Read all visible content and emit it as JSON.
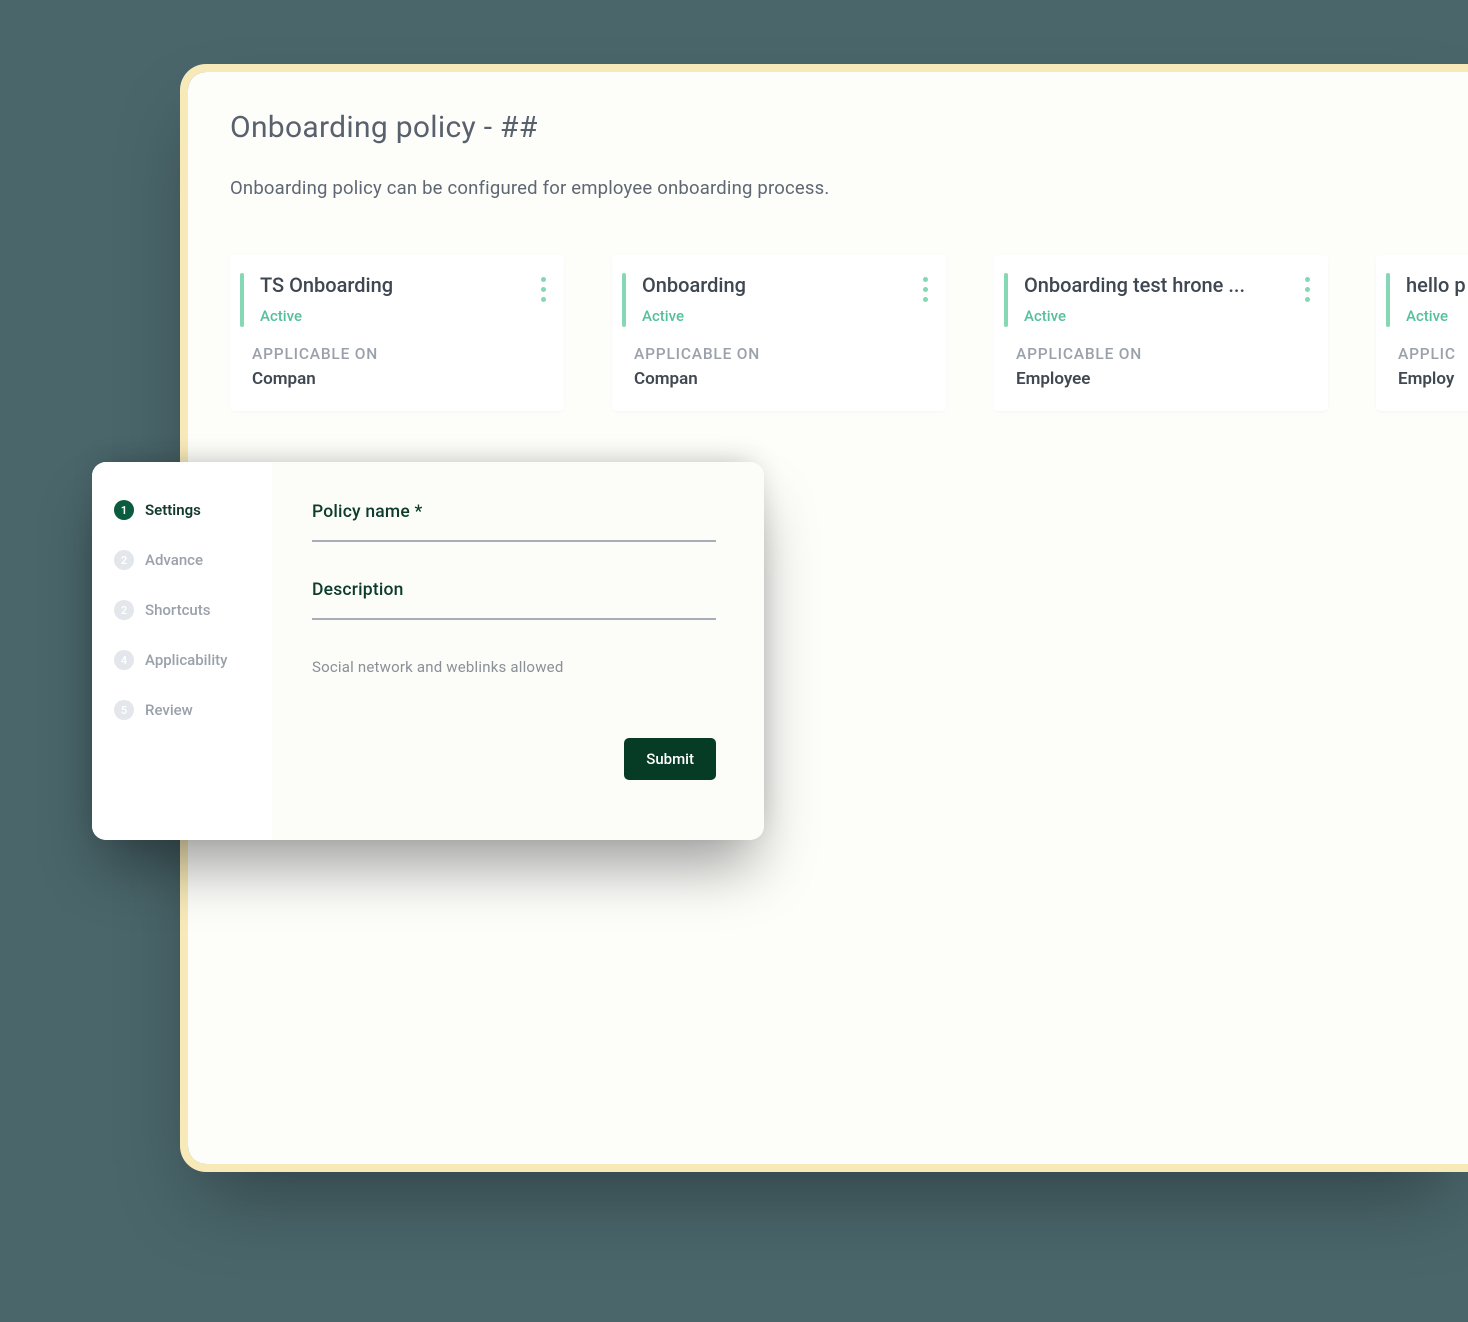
{
  "page": {
    "title": "Onboarding policy - ##",
    "subtitle": "Onboarding policy can be configured for employee onboarding process."
  },
  "cards": [
    {
      "title": "TS Onboarding",
      "status": "Active",
      "label": "APPLICABLE ON",
      "value": "Compan"
    },
    {
      "title": "Onboarding",
      "status": "Active",
      "label": "APPLICABLE ON",
      "value": "Compan"
    },
    {
      "title": "Onboarding test hrone ...",
      "status": "Active",
      "label": "APPLICABLE ON",
      "value": "Employee"
    },
    {
      "title": "hello p",
      "status": "Active",
      "label": "APPLIC",
      "value": "Employ"
    }
  ],
  "form": {
    "steps": [
      {
        "n": "1",
        "label": "Settings",
        "active": true
      },
      {
        "n": "2",
        "label": "Advance",
        "active": false
      },
      {
        "n": "2",
        "label": "Shortcuts",
        "active": false
      },
      {
        "n": "4",
        "label": "Applicability",
        "active": false
      },
      {
        "n": "5",
        "label": "Review",
        "active": false
      }
    ],
    "fields": {
      "policy_name_label": "Policy name *",
      "description_label": "Description",
      "hint": "Social network and weblinks allowed"
    },
    "submit_label": "Submit"
  }
}
